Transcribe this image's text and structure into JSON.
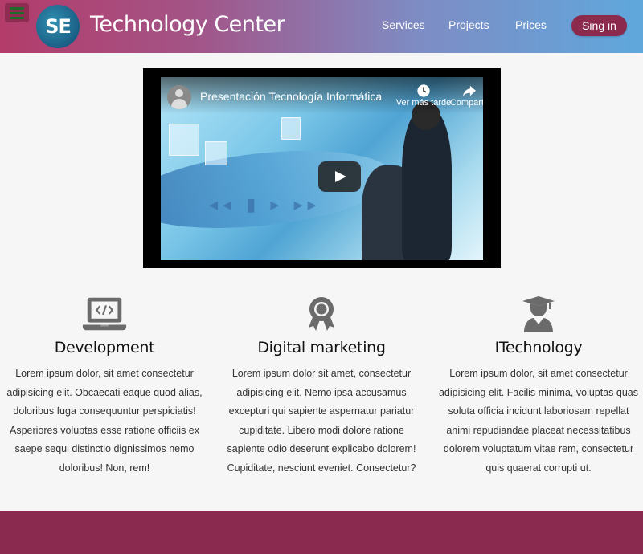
{
  "header": {
    "logo_text": "SE",
    "brand": "Technology Center",
    "nav": {
      "services": "Services",
      "projects": "Projects",
      "prices": "Prices"
    },
    "signin_label": "Sing in",
    "menu_icon": "hamburger-icon"
  },
  "video": {
    "title": "Presentación Tecnología Informática",
    "watch_later_label": "Ver más tarde",
    "share_label": "Compartir"
  },
  "features": [
    {
      "icon": "laptop-code-icon",
      "title": "Development",
      "text": "Lorem ipsum dolor, sit amet consectetur adipisicing elit. Obcaecati eaque quod alias, doloribus fuga consequuntur perspiciatis! Asperiores voluptas esse ratione officiis ex saepe sequi distinctio dignissimos nemo doloribus! Non, rem!"
    },
    {
      "icon": "award-ribbon-icon",
      "title": "Digital marketing",
      "text": "Lorem ipsum dolor sit amet, consectetur adipisicing elit. Nemo ipsa accusamus excepturi qui sapiente aspernatur pariatur cupiditate. Libero modi dolore ratione sapiente odio deserunt explicabo dolorem! Cupiditate, nesciunt eveniet. Consectetur?"
    },
    {
      "icon": "graduate-user-icon",
      "title": "ITechnology",
      "text": "Lorem ipsum dolor, sit amet consectetur adipisicing elit. Facilis minima, voluptas quas soluta officia incidunt laboriosam repellat animi repudiandae placeat necessitatibus dolorem voluptatum vitae rem, consectetur quis quaerat corrupti ut."
    }
  ],
  "colors": {
    "accent": "#8a2a4f",
    "header_gradient_start": "#b33c6a",
    "header_gradient_end": "#5fa8dc",
    "icon_gray": "#6b6b6b"
  }
}
